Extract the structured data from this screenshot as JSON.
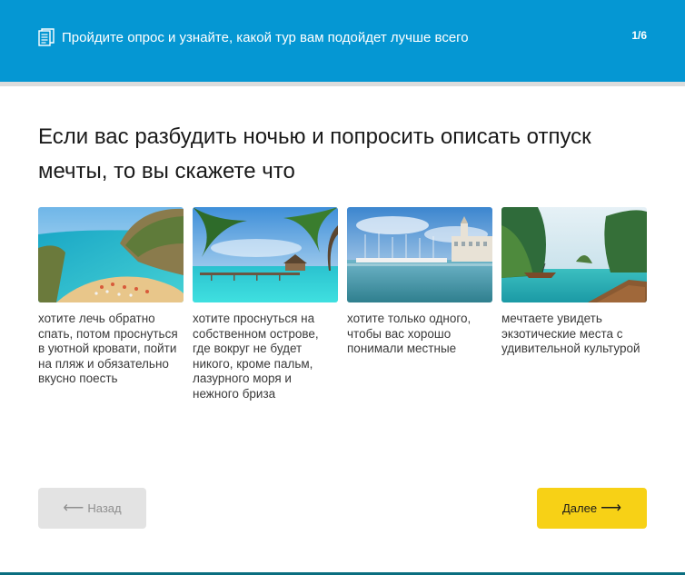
{
  "header": {
    "icon": "document-list-icon",
    "title": "Пройдите опрос и узнайте, какой тур вам подойдет лучше всего",
    "step": "1/6"
  },
  "question": {
    "text": "Если вас разбудить ночью и попросить описать отпуск мечты, то вы скажете что"
  },
  "options": [
    {
      "image": "beach-bay-photo",
      "text": "хотите лечь обратно спать, потом проснуться в уютной кровати, пойти на пляж и обязательно вкусно поесть"
    },
    {
      "image": "island-palms-photo",
      "text": "хотите проснуться на собственном острове, где вокруг не будет никого, кроме пальм, лазурного моря и нежного бриза"
    },
    {
      "image": "harbor-city-photo",
      "text": "хотите только одного, чтобы вас хорошо понимали местные"
    },
    {
      "image": "exotic-cliffs-photo",
      "text": "мечтаете увидеть экзотические места с удивительной культурой"
    }
  ],
  "navigation": {
    "back_label": "Назад",
    "back_arrow": "⟵",
    "next_label": "Далее",
    "next_arrow": "⟶"
  },
  "colors": {
    "header": "#0597d3",
    "next_button": "#f7d116",
    "back_button": "#e3e3e3"
  }
}
